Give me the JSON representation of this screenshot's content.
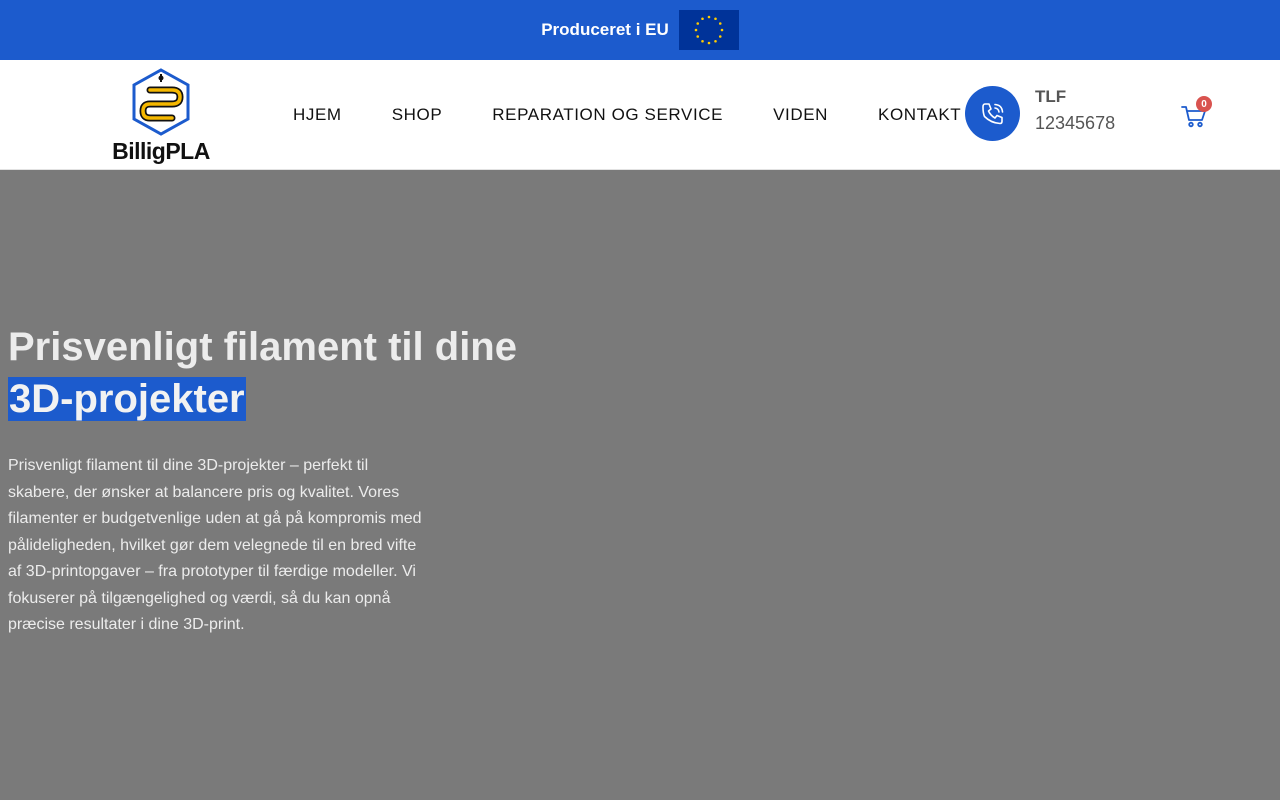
{
  "topbar": {
    "text": "Produceret i EU",
    "flag_icon": "eu-flag-icon",
    "bg_color": "#1c5bcd"
  },
  "header": {
    "logo_text": "BilligPLA",
    "nav": [
      "HJEM",
      "SHOP",
      "REPARATION OG SERVICE",
      "VIDEN",
      "KONTAKT"
    ],
    "phone_label": "TLF",
    "phone_number": "12345678",
    "phone_icon": "phone-icon",
    "cart_icon": "cart-icon",
    "cart_count": "0"
  },
  "hero": {
    "title_line1": "Prisvenligt filament til dine",
    "title_highlight": "3D-projekter",
    "body": "Prisvenligt filament til dine 3D-projekter – perfekt til skabere, der ønsker at balancere pris og kvalitet. Vores filamenter er budgetvenlige uden at gå på kompromis med pålideligheden, hvilket gør dem velegnede til en bred vifte af 3D-printopgaver – fra prototyper til færdige modeller. Vi fokuserer på tilgængelighed og værdi, så du kan opnå præcise resultater i dine 3D-print."
  },
  "colors": {
    "brand_blue": "#1c5bcd",
    "hero_bg": "#7a7a7a",
    "badge_red": "#d9534f"
  }
}
